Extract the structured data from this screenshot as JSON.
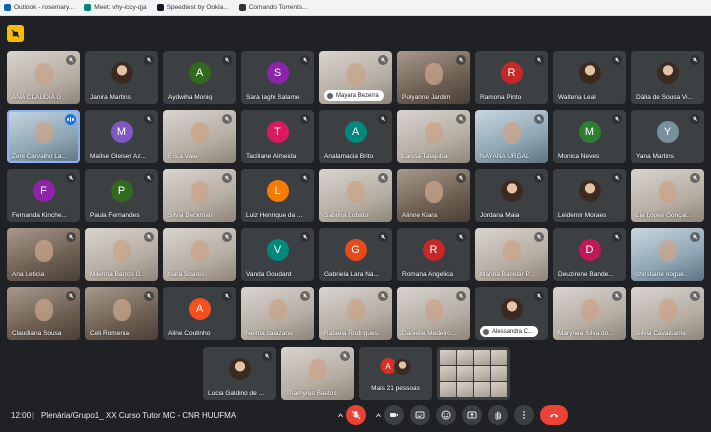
{
  "bookmarks": [
    {
      "label": "Outlook - rosemary...",
      "icon": "outlook-icon",
      "color": "#0a64ad"
    },
    {
      "label": "Meet: vhy-iccy-qja",
      "icon": "meet-icon",
      "color": "#00897b"
    },
    {
      "label": "Speedtest by Ookla...",
      "icon": "speedtest-icon",
      "color": "#141526"
    },
    {
      "label": "Comando Torrents...",
      "icon": "torrent-icon",
      "color": "#333333"
    }
  ],
  "participants": [
    {
      "name": "ANA CLAUDIA G",
      "kind": "camera",
      "tone": "light"
    },
    {
      "name": "Janira Martins",
      "kind": "photo"
    },
    {
      "name": "Aydwiha Moniq",
      "kind": "letter",
      "letter": "A",
      "color": "#33691e"
    },
    {
      "name": "Sara Iaghi Salame",
      "kind": "letter",
      "letter": "S",
      "color": "#8e24aa"
    },
    {
      "name": "Mayara Bezerra",
      "kind": "camera",
      "tone": "light",
      "pill": true
    },
    {
      "name": "Polyanne Jardim",
      "kind": "camera",
      "tone": "dark"
    },
    {
      "name": "Ramona Pinto",
      "kind": "letter",
      "letter": "R",
      "color": "#c62828"
    },
    {
      "name": "Walteria Leal",
      "kind": "photo"
    },
    {
      "name": "Dália de Sousa Vi...",
      "kind": "photo"
    },
    {
      "name": "Zeni Carvalho La...",
      "kind": "camera",
      "tone": "blue",
      "active": true
    },
    {
      "name": "Maílse Gleiser Az...",
      "kind": "letter",
      "letter": "M",
      "color": "#7e57c2"
    },
    {
      "name": "Érica Vale",
      "kind": "camera",
      "tone": "light"
    },
    {
      "name": "Taciliane Almeida",
      "kind": "letter",
      "letter": "T",
      "color": "#d81b60"
    },
    {
      "name": "Analamacia Brito",
      "kind": "letter",
      "letter": "A",
      "color": "#00897b"
    },
    {
      "name": "Laissa Tatajuba",
      "kind": "camera",
      "tone": "light"
    },
    {
      "name": "NAYANA URGAL",
      "kind": "camera",
      "tone": "blue"
    },
    {
      "name": "Monica Neves",
      "kind": "letter",
      "letter": "M",
      "color": "#2e7d32"
    },
    {
      "name": "Yana Martins",
      "kind": "letter",
      "letter": "Y",
      "color": "#78909c"
    },
    {
      "name": "Fernanda Kinche...",
      "kind": "letter",
      "letter": "F",
      "color": "#8e24aa"
    },
    {
      "name": "Paula Fernandes",
      "kind": "letter",
      "letter": "P",
      "color": "#33691e"
    },
    {
      "name": "Silvia Beckman",
      "kind": "camera",
      "tone": "light"
    },
    {
      "name": "Luiz Henrique da ...",
      "kind": "letter",
      "letter": "L",
      "color": "#f57c00"
    },
    {
      "name": "Sabrina Lobato",
      "kind": "camera",
      "tone": "light"
    },
    {
      "name": "Alinne Kiara",
      "kind": "camera",
      "tone": "dark"
    },
    {
      "name": "Jordana Maia",
      "kind": "photo"
    },
    {
      "name": "Leidemir Moraes",
      "kind": "photo"
    },
    {
      "name": "Lia Lopes Gonçal...",
      "kind": "camera",
      "tone": "light"
    },
    {
      "name": "Ana Leticia",
      "kind": "camera",
      "tone": "dark"
    },
    {
      "name": "Milenna Barros G...",
      "kind": "camera",
      "tone": "light"
    },
    {
      "name": "Nara Soares",
      "kind": "camera",
      "tone": "light"
    },
    {
      "name": "Vanda Goudard",
      "kind": "letter",
      "letter": "V",
      "color": "#00897b"
    },
    {
      "name": "Gabriela Lara Na...",
      "kind": "letter",
      "letter": "G",
      "color": "#e64a19"
    },
    {
      "name": "Romana Angelica",
      "kind": "letter",
      "letter": "R",
      "color": "#c62828"
    },
    {
      "name": "Marina Bacelar P...",
      "kind": "camera",
      "tone": "light"
    },
    {
      "name": "Deuzirene Bande...",
      "kind": "letter",
      "letter": "D",
      "color": "#c2185b"
    },
    {
      "name": "christiane nogue...",
      "kind": "camera",
      "tone": "blue"
    },
    {
      "name": "Claudiana Sousa",
      "kind": "camera",
      "tone": "dark"
    },
    {
      "name": "Celi Romenia",
      "kind": "camera",
      "tone": "dark"
    },
    {
      "name": "Aline Coutinho",
      "kind": "letter",
      "letter": "A",
      "color": "#f4511e"
    },
    {
      "name": "Neima calazans",
      "kind": "camera",
      "tone": "light"
    },
    {
      "name": "Rafaela Rodrigues",
      "kind": "camera",
      "tone": "light"
    },
    {
      "name": "Danielle Medeiro...",
      "kind": "camera",
      "tone": "light"
    },
    {
      "name": "Alessandra C...",
      "kind": "photo",
      "pill": true
    },
    {
      "name": "Marynea Silva do...",
      "kind": "camera",
      "tone": "light"
    },
    {
      "name": "Silvia Cavalcante",
      "kind": "camera",
      "tone": "light"
    }
  ],
  "last_row": [
    {
      "name": "Lucia Galdino de ...",
      "kind": "photo"
    },
    {
      "name": "Thamyres Bastos",
      "kind": "camera",
      "tone": "light"
    },
    {
      "name": "Mais 21 pessoas",
      "kind": "more",
      "letter": "A"
    },
    {
      "name": "",
      "kind": "grid"
    }
  ],
  "footer": {
    "time": "12:00",
    "separator": "|",
    "meeting_title": "Plenária/Grupo1_ XX Curso Tutor MC - CNR HUUFMA"
  },
  "colors": {
    "background": "#202124",
    "tile": "#3c4043",
    "end_call": "#ea4335",
    "accent": "#8ab4f8"
  }
}
